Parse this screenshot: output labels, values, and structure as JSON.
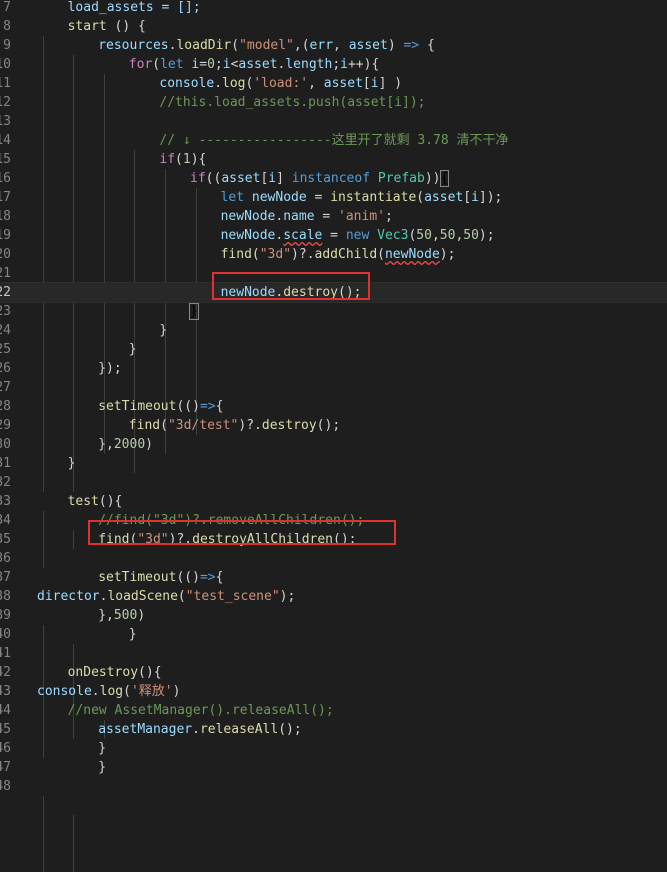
{
  "editor": {
    "current_line_number": "22",
    "lines": [
      {
        "n": "7",
        "tokens": [
          {
            "t": "load_assets = [];",
            "c": "var"
          }
        ]
      },
      {
        "n": "8",
        "tokens": [
          {
            "t": "start",
            "c": "fn"
          },
          {
            "t": " () {",
            "c": "pun"
          }
        ]
      },
      {
        "n": "9",
        "tokens": [
          {
            "t": "resources",
            "c": "var"
          },
          {
            "t": ".",
            "c": "pun"
          },
          {
            "t": "loadDir",
            "c": "fn"
          },
          {
            "t": "(",
            "c": "pun"
          },
          {
            "t": "\"model\"",
            "c": "str"
          },
          {
            "t": ",(",
            "c": "pun"
          },
          {
            "t": "err",
            "c": "var"
          },
          {
            "t": ", ",
            "c": "pun"
          },
          {
            "t": "asset",
            "c": "var"
          },
          {
            "t": ") ",
            "c": "pun"
          },
          {
            "t": "=>",
            "c": "kw"
          },
          {
            "t": " {",
            "c": "pun"
          }
        ]
      },
      {
        "n": "10",
        "tokens": [
          {
            "t": "for",
            "c": "ctl"
          },
          {
            "t": "(",
            "c": "pun"
          },
          {
            "t": "let",
            "c": "kw"
          },
          {
            "t": " ",
            "c": "pun"
          },
          {
            "t": "i",
            "c": "var"
          },
          {
            "t": "=",
            "c": "pun"
          },
          {
            "t": "0",
            "c": "num"
          },
          {
            "t": ";",
            "c": "pun"
          },
          {
            "t": "i",
            "c": "var"
          },
          {
            "t": "<",
            "c": "pun"
          },
          {
            "t": "asset",
            "c": "var"
          },
          {
            "t": ".",
            "c": "pun"
          },
          {
            "t": "length",
            "c": "var"
          },
          {
            "t": ";",
            "c": "pun"
          },
          {
            "t": "i",
            "c": "var"
          },
          {
            "t": "++){",
            "c": "pun"
          }
        ]
      },
      {
        "n": "11",
        "tokens": [
          {
            "t": "console",
            "c": "var"
          },
          {
            "t": ".",
            "c": "pun"
          },
          {
            "t": "log",
            "c": "fn"
          },
          {
            "t": "(",
            "c": "pun"
          },
          {
            "t": "'load:'",
            "c": "str"
          },
          {
            "t": ", ",
            "c": "pun"
          },
          {
            "t": "asset",
            "c": "var"
          },
          {
            "t": "[",
            "c": "pun"
          },
          {
            "t": "i",
            "c": "var"
          },
          {
            "t": "] )",
            "c": "pun"
          }
        ]
      },
      {
        "n": "12",
        "tokens": [
          {
            "t": "//this.load_assets.push(asset[i]);",
            "c": "cmt"
          }
        ]
      },
      {
        "n": "13",
        "tokens": []
      },
      {
        "n": "14",
        "tokens": [
          {
            "t": "// ↓ -----------------这里开了就剩 3.78 清不干净",
            "c": "cmt"
          }
        ]
      },
      {
        "n": "15",
        "tokens": [
          {
            "t": "if",
            "c": "ctl"
          },
          {
            "t": "(",
            "c": "pun"
          },
          {
            "t": "1",
            "c": "num"
          },
          {
            "t": "){",
            "c": "pun"
          }
        ]
      },
      {
        "n": "16",
        "tokens": [
          {
            "t": "if",
            "c": "ctl"
          },
          {
            "t": "((",
            "c": "pun"
          },
          {
            "t": "asset",
            "c": "var"
          },
          {
            "t": "[",
            "c": "pun"
          },
          {
            "t": "i",
            "c": "var"
          },
          {
            "t": "] ",
            "c": "pun"
          },
          {
            "t": "instanceof",
            "c": "kw"
          },
          {
            "t": " ",
            "c": "pun"
          },
          {
            "t": "Prefab",
            "c": "type"
          },
          {
            "t": "))",
            "c": "pun"
          },
          {
            "t": "{",
            "c": "br"
          }
        ]
      },
      {
        "n": "17",
        "tokens": [
          {
            "t": "let",
            "c": "kw"
          },
          {
            "t": " ",
            "c": "pun"
          },
          {
            "t": "newNode",
            "c": "var"
          },
          {
            "t": " = ",
            "c": "pun"
          },
          {
            "t": "instantiate",
            "c": "fn"
          },
          {
            "t": "(",
            "c": "pun"
          },
          {
            "t": "asset",
            "c": "var"
          },
          {
            "t": "[",
            "c": "pun"
          },
          {
            "t": "i",
            "c": "var"
          },
          {
            "t": "]);",
            "c": "pun"
          }
        ]
      },
      {
        "n": "18",
        "tokens": [
          {
            "t": "newNode",
            "c": "var"
          },
          {
            "t": ".",
            "c": "pun"
          },
          {
            "t": "name",
            "c": "var"
          },
          {
            "t": " = ",
            "c": "pun"
          },
          {
            "t": "'anim'",
            "c": "str"
          },
          {
            "t": ";",
            "c": "pun"
          }
        ]
      },
      {
        "n": "19",
        "tokens": [
          {
            "t": "newNode",
            "c": "var"
          },
          {
            "t": ".",
            "c": "pun"
          },
          {
            "t": "scale",
            "c": "var sq"
          },
          {
            "t": " = ",
            "c": "pun"
          },
          {
            "t": "new",
            "c": "kw"
          },
          {
            "t": " ",
            "c": "pun"
          },
          {
            "t": "Vec3",
            "c": "type"
          },
          {
            "t": "(",
            "c": "pun"
          },
          {
            "t": "50",
            "c": "num"
          },
          {
            "t": ",",
            "c": "pun"
          },
          {
            "t": "50",
            "c": "num"
          },
          {
            "t": ",",
            "c": "pun"
          },
          {
            "t": "50",
            "c": "num"
          },
          {
            "t": ");",
            "c": "pun"
          }
        ]
      },
      {
        "n": "20",
        "tokens": [
          {
            "t": "find",
            "c": "fn"
          },
          {
            "t": "(",
            "c": "pun"
          },
          {
            "t": "\"3d\"",
            "c": "str"
          },
          {
            "t": ")?.",
            "c": "pun"
          },
          {
            "t": "addChild",
            "c": "fn"
          },
          {
            "t": "(",
            "c": "pun"
          },
          {
            "t": "newNode",
            "c": "var sq"
          },
          {
            "t": ");",
            "c": "pun"
          }
        ]
      },
      {
        "n": "21",
        "tokens": []
      },
      {
        "n": "22",
        "tokens": [
          {
            "t": "newNode",
            "c": "var"
          },
          {
            "t": ".",
            "c": "pun"
          },
          {
            "t": "destroy",
            "c": "fn"
          },
          {
            "t": "();",
            "c": "pun"
          }
        ]
      },
      {
        "n": "23",
        "tokens": [
          {
            "t": "}",
            "c": "br"
          }
        ]
      },
      {
        "n": "24",
        "tokens": [
          {
            "t": "}",
            "c": "pun"
          }
        ]
      },
      {
        "n": "25",
        "tokens": [
          {
            "t": "}",
            "c": "pun"
          }
        ]
      },
      {
        "n": "26",
        "tokens": [
          {
            "t": "});",
            "c": "pun"
          }
        ]
      },
      {
        "n": "27",
        "tokens": []
      },
      {
        "n": "28",
        "tokens": [
          {
            "t": "setTimeout",
            "c": "fn"
          },
          {
            "t": "(()",
            "c": "pun"
          },
          {
            "t": "=>",
            "c": "kw"
          },
          {
            "t": "{",
            "c": "pun"
          }
        ]
      },
      {
        "n": "29",
        "tokens": [
          {
            "t": "find",
            "c": "fn"
          },
          {
            "t": "(",
            "c": "pun"
          },
          {
            "t": "\"3d/test\"",
            "c": "str"
          },
          {
            "t": ")?.",
            "c": "pun"
          },
          {
            "t": "destroy",
            "c": "fn"
          },
          {
            "t": "();",
            "c": "pun"
          }
        ]
      },
      {
        "n": "30",
        "tokens": [
          {
            "t": "},",
            "c": "pun"
          },
          {
            "t": "2000",
            "c": "num"
          },
          {
            "t": ")",
            "c": "pun"
          }
        ]
      },
      {
        "n": "31",
        "tokens": [
          {
            "t": "}",
            "c": "pun"
          }
        ]
      },
      {
        "n": "32",
        "tokens": []
      },
      {
        "n": "33",
        "tokens": [
          {
            "t": "test",
            "c": "fn"
          },
          {
            "t": "(){",
            "c": "pun"
          }
        ]
      },
      {
        "n": "34",
        "tokens": [
          {
            "t": "//find(\"3d\")?.removeAllChildren();",
            "c": "cmt"
          }
        ]
      },
      {
        "n": "35",
        "tokens": [
          {
            "t": "find",
            "c": "fn"
          },
          {
            "t": "(",
            "c": "pun"
          },
          {
            "t": "\"3d\"",
            "c": "str"
          },
          {
            "t": ")?.",
            "c": "pun"
          },
          {
            "t": "destroyAllChildren",
            "c": "fn"
          },
          {
            "t": "();",
            "c": "pun"
          }
        ]
      },
      {
        "n": "36",
        "tokens": []
      },
      {
        "n": "37",
        "tokens": [
          {
            "t": "setTimeout",
            "c": "fn"
          },
          {
            "t": "(()",
            "c": "pun"
          },
          {
            "t": "=>",
            "c": "kw"
          },
          {
            "t": "{",
            "c": "pun"
          }
        ]
      },
      {
        "n": "38",
        "tokens": [
          {
            "t": "director",
            "c": "var"
          },
          {
            "t": ".",
            "c": "pun"
          },
          {
            "t": "loadScene",
            "c": "fn"
          },
          {
            "t": "(",
            "c": "pun"
          },
          {
            "t": "\"test_scene\"",
            "c": "str"
          },
          {
            "t": ");",
            "c": "pun"
          }
        ]
      },
      {
        "n": "39",
        "tokens": [
          {
            "t": "},",
            "c": "pun"
          },
          {
            "t": "500",
            "c": "num"
          },
          {
            "t": ")",
            "c": "pun"
          }
        ]
      },
      {
        "n": "40",
        "tokens": [
          {
            "t": "}",
            "c": "pun"
          }
        ]
      },
      {
        "n": "41",
        "tokens": []
      },
      {
        "n": "42",
        "tokens": [
          {
            "t": "onDestroy",
            "c": "fn"
          },
          {
            "t": "(){",
            "c": "pun"
          }
        ]
      },
      {
        "n": "43",
        "tokens": [
          {
            "t": "console",
            "c": "var"
          },
          {
            "t": ".",
            "c": "pun"
          },
          {
            "t": "log",
            "c": "fn"
          },
          {
            "t": "(",
            "c": "pun"
          },
          {
            "t": "'释放'",
            "c": "str"
          },
          {
            "t": ")",
            "c": "pun"
          }
        ]
      },
      {
        "n": "44",
        "tokens": [
          {
            "t": "//new AssetManager().releaseAll();",
            "c": "cmt"
          }
        ]
      },
      {
        "n": "45",
        "tokens": [
          {
            "t": "assetManager",
            "c": "var"
          },
          {
            "t": ".",
            "c": "pun"
          },
          {
            "t": "releaseAll",
            "c": "fn"
          },
          {
            "t": "();",
            "c": "pun"
          }
        ]
      },
      {
        "n": "46",
        "tokens": [
          {
            "t": "}",
            "c": "pun"
          }
        ]
      },
      {
        "n": "47",
        "tokens": [
          {
            "t": "}",
            "c": "pun"
          }
        ]
      },
      {
        "n": "48",
        "tokens": []
      }
    ]
  },
  "colors": {
    "background": "#1e1e1e",
    "keyword": "#569cd6",
    "control": "#c586c0",
    "variable": "#9cdcfe",
    "function": "#dcdcaa",
    "string": "#ce9178",
    "number": "#b5cea8",
    "comment": "#6a9955",
    "type": "#4ec9b0",
    "highlight_box": "#e03131"
  }
}
